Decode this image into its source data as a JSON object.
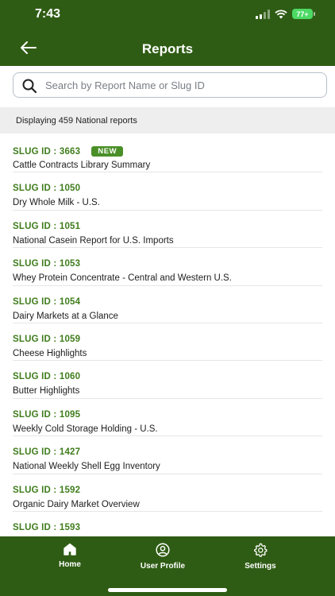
{
  "status_bar": {
    "time": "7:43",
    "battery": "77+"
  },
  "header": {
    "title": "Reports"
  },
  "search": {
    "placeholder": "Search by Report Name or Slug ID"
  },
  "summary": {
    "text": "Displaying 459 National reports"
  },
  "reports": [
    {
      "slug": "SLUG ID : 3663",
      "badge": "NEW",
      "name": "Cattle Contracts Library Summary"
    },
    {
      "slug": "SLUG ID : 1050",
      "name": "Dry Whole Milk - U.S."
    },
    {
      "slug": "SLUG ID : 1051",
      "name": "National Casein Report for U.S. Imports"
    },
    {
      "slug": "SLUG ID : 1053",
      "name": "Whey Protein Concentrate - Central and Western U.S."
    },
    {
      "slug": "SLUG ID : 1054",
      "name": "Dairy Markets at a Glance"
    },
    {
      "slug": "SLUG ID : 1059",
      "name": "Cheese Highlights"
    },
    {
      "slug": "SLUG ID : 1060",
      "name": "Butter Highlights"
    },
    {
      "slug": "SLUG ID : 1095",
      "name": "Weekly Cold Storage Holding - U.S."
    },
    {
      "slug": "SLUG ID : 1427",
      "name": "National Weekly Shell Egg Inventory"
    },
    {
      "slug": "SLUG ID : 1592",
      "name": "Organic Dairy Market Overview"
    },
    {
      "slug": "SLUG ID : 1593",
      "name": ""
    }
  ],
  "tabs": [
    {
      "label": "Home",
      "icon": "home-icon"
    },
    {
      "label": "User Profile",
      "icon": "user-profile-icon"
    },
    {
      "label": "Settings",
      "icon": "gear-icon"
    }
  ],
  "colors": {
    "brand_green": "#2f5c14",
    "slug_green": "#3f7d1c",
    "badge_green": "#4a8f28"
  }
}
